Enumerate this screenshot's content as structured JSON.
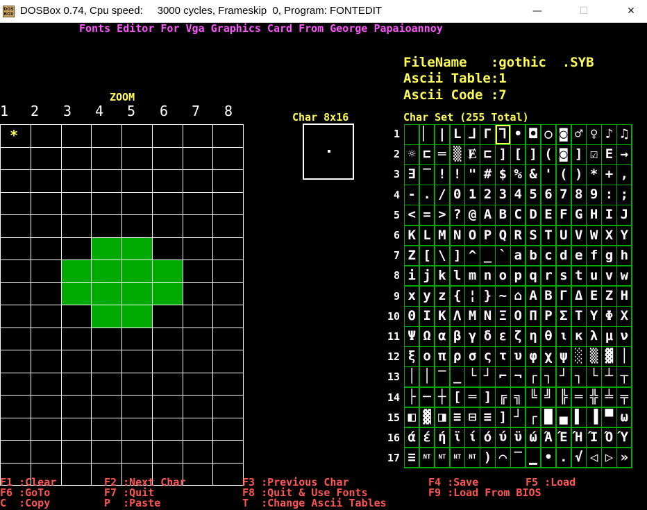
{
  "window": {
    "title": "DOSBox 0.74, Cpu speed:     3000 cycles, Frameskip  0, Program: FONTEDIT",
    "icon_label": "DOS BOX",
    "minimize": "—",
    "maximize": "☐",
    "close": "✕"
  },
  "header": {
    "title": "Fonts Editor For Vga Graphics Card From George Papaioannoy"
  },
  "info": {
    "filename": "FileName   :gothic  .SYB",
    "ascii_table": "Ascii Table:1",
    "ascii_code": "Ascii Code :7"
  },
  "zoom": {
    "label": "ZOOM",
    "columns": [
      "1",
      "2",
      "3",
      "4",
      "5",
      "6",
      "7",
      "8"
    ],
    "cursor_mark": "*",
    "rows": 16,
    "cols": 8,
    "on_cells": [
      [
        5,
        3
      ],
      [
        5,
        4
      ],
      [
        6,
        2
      ],
      [
        6,
        3
      ],
      [
        6,
        4
      ],
      [
        6,
        5
      ],
      [
        7,
        2
      ],
      [
        7,
        3
      ],
      [
        7,
        4
      ],
      [
        7,
        5
      ],
      [
        8,
        3
      ],
      [
        8,
        4
      ]
    ]
  },
  "preview": {
    "label": "Char 8x16"
  },
  "charset": {
    "label": "Char Set (255 Total)",
    "row_numbers": [
      "1",
      "2",
      "3",
      "4",
      "5",
      "6",
      "7",
      "8",
      "9",
      "10",
      "11",
      "12",
      "13",
      "14",
      "15",
      "16",
      "17"
    ],
    "selected": [
      0,
      6
    ],
    "rows": [
      [
        " ",
        "▏",
        "|",
        "L",
        "⅃",
        "Γ",
        "⅂",
        "•",
        "◘",
        "○",
        "◙",
        "♂",
        "♀",
        "♪",
        "♫"
      ],
      [
        "☼",
        "⊏",
        "═",
        "▒",
        "Ɇ",
        "⊏",
        "]",
        "[",
        "]",
        "(",
        "◙",
        "]",
        "☑",
        "E",
        "→"
      ],
      [
        "∃",
        "‾",
        "!",
        "!",
        "\"",
        "#",
        "$",
        "%",
        "&",
        "'",
        "(",
        ")",
        "*",
        "+",
        ","
      ],
      [
        "-",
        ".",
        "/",
        "0",
        "1",
        "2",
        "3",
        "4",
        "5",
        "6",
        "7",
        "8",
        "9",
        ":",
        ";"
      ],
      [
        "<",
        "=",
        ">",
        "?",
        "@",
        "A",
        "B",
        "C",
        "D",
        "E",
        "F",
        "G",
        "H",
        "I",
        "J"
      ],
      [
        "K",
        "L",
        "M",
        "N",
        "O",
        "P",
        "Q",
        "R",
        "S",
        "T",
        "U",
        "V",
        "W",
        "X",
        "Y"
      ],
      [
        "Z",
        "[",
        "\\",
        "]",
        "^",
        "_",
        "`",
        "a",
        "b",
        "c",
        "d",
        "e",
        "f",
        "g",
        "h"
      ],
      [
        "i",
        "j",
        "k",
        "l",
        "m",
        "n",
        "o",
        "p",
        "q",
        "r",
        "s",
        "t",
        "u",
        "v",
        "w"
      ],
      [
        "x",
        "y",
        "z",
        "{",
        "¦",
        "}",
        "~",
        "⌂",
        "A",
        "B",
        "Γ",
        "Δ",
        "E",
        "Z",
        "H"
      ],
      [
        "Θ",
        "I",
        "K",
        "Λ",
        "M",
        "N",
        "Ξ",
        "O",
        "Π",
        "P",
        "Σ",
        "T",
        "Y",
        "Φ",
        "X"
      ],
      [
        "Ψ",
        "Ω",
        "α",
        "β",
        "γ",
        "δ",
        "ε",
        "ζ",
        "η",
        "θ",
        "ι",
        "κ",
        "λ",
        "μ",
        "ν"
      ],
      [
        "ξ",
        "ο",
        "π",
        "ρ",
        "σ",
        "ς",
        "τ",
        "υ",
        "φ",
        "χ",
        "ψ",
        "░",
        "▒",
        "▓",
        "│"
      ],
      [
        "│",
        "│",
        "‾",
        "_",
        "└",
        "┘",
        "⌐",
        "¬",
        "┌",
        "┐",
        "┘",
        "┐",
        "└",
        "┴",
        "┬"
      ],
      [
        "├",
        "─",
        "┼",
        "[",
        "═",
        "]",
        "╔",
        "╗",
        "╚",
        "╝",
        "╠",
        "═",
        "╬",
        "╧",
        "╤"
      ],
      [
        "◧",
        "▓",
        "◨",
        "≡",
        "⊟",
        "≡",
        "]",
        "┘",
        "┌",
        "█",
        "▄",
        "▌",
        "▐",
        "▀",
        "ω"
      ],
      [
        "ά",
        "έ",
        "ή",
        "ϊ",
        "ί",
        "ό",
        "ύ",
        "ϋ",
        "ώ",
        "Ά",
        "Έ",
        "Ή",
        "Ί",
        "Ό",
        "Ύ"
      ],
      [
        "≡",
        "NT",
        "NT",
        "NT",
        "NT",
        ")",
        "⌒",
        "‾",
        "▁",
        "•",
        ".",
        "√",
        "◁",
        "▷",
        "»"
      ]
    ]
  },
  "help": {
    "line1": [
      {
        "key": "F1",
        "sep": " :",
        "label": "Clear"
      },
      {
        "key": "F2",
        "sep": " :",
        "label": "Next Char"
      },
      {
        "key": "F3",
        "sep": " :",
        "label": "Previous Char"
      },
      {
        "key": "F4",
        "sep": " :",
        "label": "Save"
      },
      {
        "key": "F5",
        "sep": " :",
        "label": "Load"
      }
    ],
    "line2": [
      {
        "key": "F6",
        "sep": " :",
        "label": "GoTo"
      },
      {
        "key": "F7",
        "sep": " :",
        "label": "Quit"
      },
      {
        "key": "F8",
        "sep": " :",
        "label": "Quit & Use Fonts"
      },
      {
        "key": "F9",
        "sep": " :",
        "label": "Load From BIOS"
      }
    ],
    "line3": [
      {
        "key": "C",
        "sep": "  :",
        "label": "Copy"
      },
      {
        "key": "P",
        "sep": "  :",
        "label": "Paste"
      },
      {
        "key": "T",
        "sep": "  :",
        "label": "Change Ascii Tables"
      }
    ]
  },
  "colors": {
    "background": "#000000",
    "title": "#ff55ff",
    "info": "#ffff55",
    "help": "#ff5555",
    "grid_on": "#00aa00",
    "charset_border": "#00aa00"
  }
}
